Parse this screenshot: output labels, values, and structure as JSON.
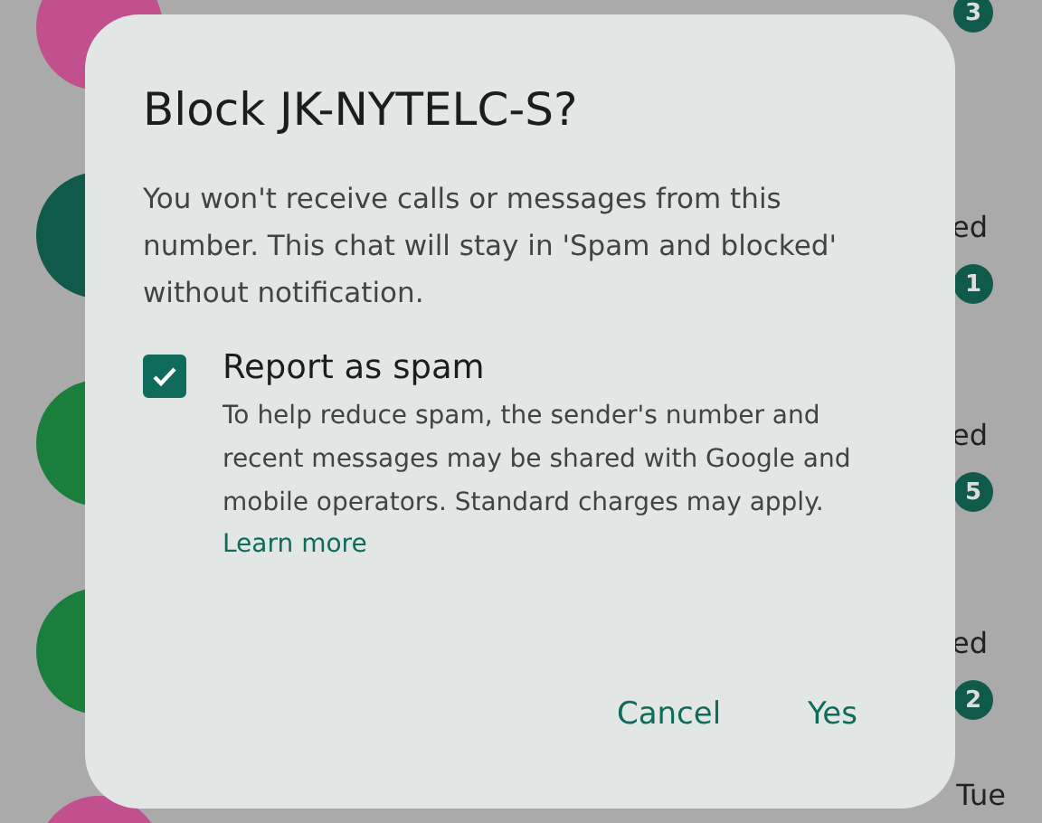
{
  "conversations": [
    {
      "color": "#c2508f",
      "badge": "3"
    },
    {
      "color": "#0f5a4b",
      "side_text": "ed",
      "badge": "1"
    },
    {
      "color": "#1a7f3d",
      "side_text": "ed",
      "badge": "5"
    },
    {
      "color": "#1a7f3d",
      "side_text": "ed",
      "badge": "2"
    },
    {
      "color": "#c2508f",
      "side_text": "Tue"
    }
  ],
  "dialog": {
    "title": "Block JK-NYTELC-S?",
    "message": "You won't receive calls or messages from this number. This chat will stay in 'Spam and blocked' without notification.",
    "option": {
      "label": "Report as spam",
      "checked": true,
      "description": "To help reduce spam, the sender's number and recent messages may be shared with Google and mobile operators. Standard charges may apply.",
      "link": "Learn more"
    },
    "buttons": [
      "Cancel",
      "Yes"
    ]
  }
}
